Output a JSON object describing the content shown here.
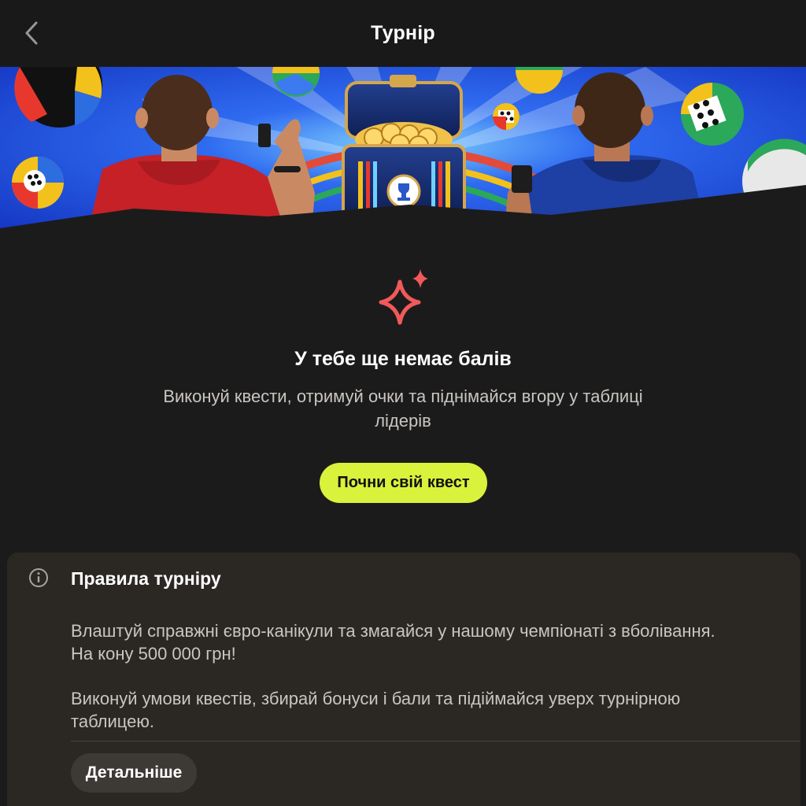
{
  "header": {
    "title": "Турнір",
    "back_icon": "chevron-left-icon"
  },
  "banner": {
    "description_icons": [
      "ball-icon",
      "treasure-chest-icon",
      "trophy-icon"
    ]
  },
  "empty_state": {
    "icon": "sparkle-icon",
    "icon_color": "#f05a5a",
    "title": "У тебе ще немає балів",
    "description": "Виконуй квести, отримуй очки та піднімайся вгору у таблиці лідерів",
    "cta_label": "Почни свій квест",
    "cta_color": "#d9f23b"
  },
  "rules": {
    "icon": "info-icon",
    "title": "Правила турніру",
    "paragraph1": "Влаштуй справжні євро-канікули та змагайся у нашому чемпіонаті з вболівання. На кону 500 000 грн!",
    "paragraph2": "Виконуй умови квестів, збирай бонуси і бали та підіймайся уверх турнірною таблицею.",
    "details_label": "Детальніше"
  }
}
